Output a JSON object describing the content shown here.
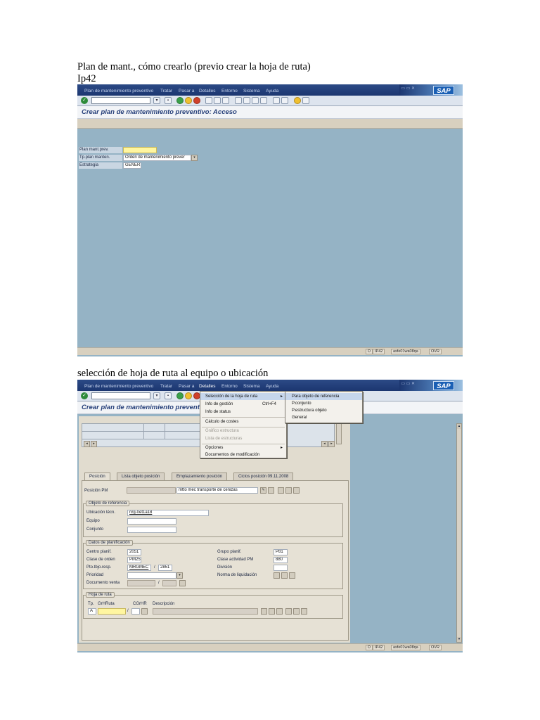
{
  "doc": {
    "heading_line1": "Plan de mant., cómo crearlo (previo crear la hoja de ruta)",
    "heading_line2": "Ip42",
    "caption2": "selección de hoja de ruta al equipo o ubicación"
  },
  "sap": {
    "logo": "SAP",
    "menu": [
      "Plan de mantenimiento preventivo",
      "Tratar",
      "Pasar a",
      "Detalles",
      "Entorno",
      "Sistema",
      "Ayuda"
    ],
    "status": {
      "session": "IP42",
      "server": "asfe01wa08qa",
      "mode": "OVR",
      "flag": "D"
    },
    "colors": {
      "menubar": "#1c3670",
      "body": "#95b3c5",
      "required_field": "#fff6a0",
      "title": "#27407a"
    }
  },
  "screen1": {
    "title": "Crear plan de mantenimiento preventivo: Acceso",
    "fields": [
      {
        "label": "Plan mant.prev.",
        "value": ""
      },
      {
        "label": "Tp.plan manten.",
        "value": "Orden de mantenimiento prever"
      },
      {
        "label": "Estrategia",
        "value": "GENER1"
      }
    ]
  },
  "screen2": {
    "title": "Crear plan de mantenimiento preventi",
    "detalles_menu": [
      {
        "label": "Selección de la hoja de ruta",
        "shortcut": "",
        "submenu": true,
        "disabled": false
      },
      {
        "label": "Info de gestión",
        "shortcut": "Ctrl+F4",
        "submenu": false,
        "disabled": false
      },
      {
        "label": "Info de status",
        "shortcut": "",
        "submenu": false,
        "disabled": false
      },
      {
        "label": "Cálculo de costes",
        "shortcut": "",
        "submenu": false,
        "disabled": false
      },
      {
        "label": "Gráfico estructura",
        "shortcut": "",
        "submenu": false,
        "disabled": true
      },
      {
        "label": "Lista de estructuras",
        "shortcut": "",
        "submenu": false,
        "disabled": true
      },
      {
        "label": "Opciones",
        "shortcut": "",
        "submenu": true,
        "disabled": false
      },
      {
        "label": "Documentos de modificación",
        "shortcut": "",
        "submenu": false,
        "disabled": false
      }
    ],
    "submenu": [
      "Para objeto de referencia",
      "P.conjunto",
      "P.estructura objeto",
      "General"
    ],
    "tabs": [
      "Posición",
      "Lista objeto posición",
      "Emplazamiento posición",
      "Ciclos posición 09.11.2008"
    ],
    "posicion_pm": {
      "label": "Posición PM",
      "value": "mtto mec transporte de cenizas"
    },
    "objeto_referencia": {
      "title": "Objeto de referencia",
      "fields": [
        {
          "label": "Ubicación técn.",
          "value": "nrg-0et1a18"
        },
        {
          "label": "Equipo",
          "value": ""
        },
        {
          "label": "Conjunto",
          "value": ""
        }
      ]
    },
    "datos_planificacion": {
      "title": "Datos de planificación",
      "left": [
        {
          "label": "Centro planif.",
          "value": "2051"
        },
        {
          "label": "Clase de orden",
          "value": "PM25"
        },
        {
          "label": "Pto.tbjo.resp.",
          "value": "MRGMEC",
          "value2": "2851"
        },
        {
          "label": "Prioridad",
          "value": ""
        },
        {
          "label": "Documento venta",
          "value": ""
        }
      ],
      "right": [
        {
          "label": "Grupo planif.",
          "value": "P81"
        },
        {
          "label": "Clase actividad PM",
          "value": "880"
        },
        {
          "label": "División",
          "value": ""
        },
        {
          "label": "Norma de liquidación",
          "value": ""
        }
      ]
    },
    "hoja_ruta": {
      "title": "Hoja de ruta",
      "columns": [
        "Tp.",
        "GrHRuta",
        "CGrHR",
        "Descripción"
      ],
      "row": {
        "tp": "A",
        "grhruta": "",
        "cgrhr": ""
      }
    }
  }
}
